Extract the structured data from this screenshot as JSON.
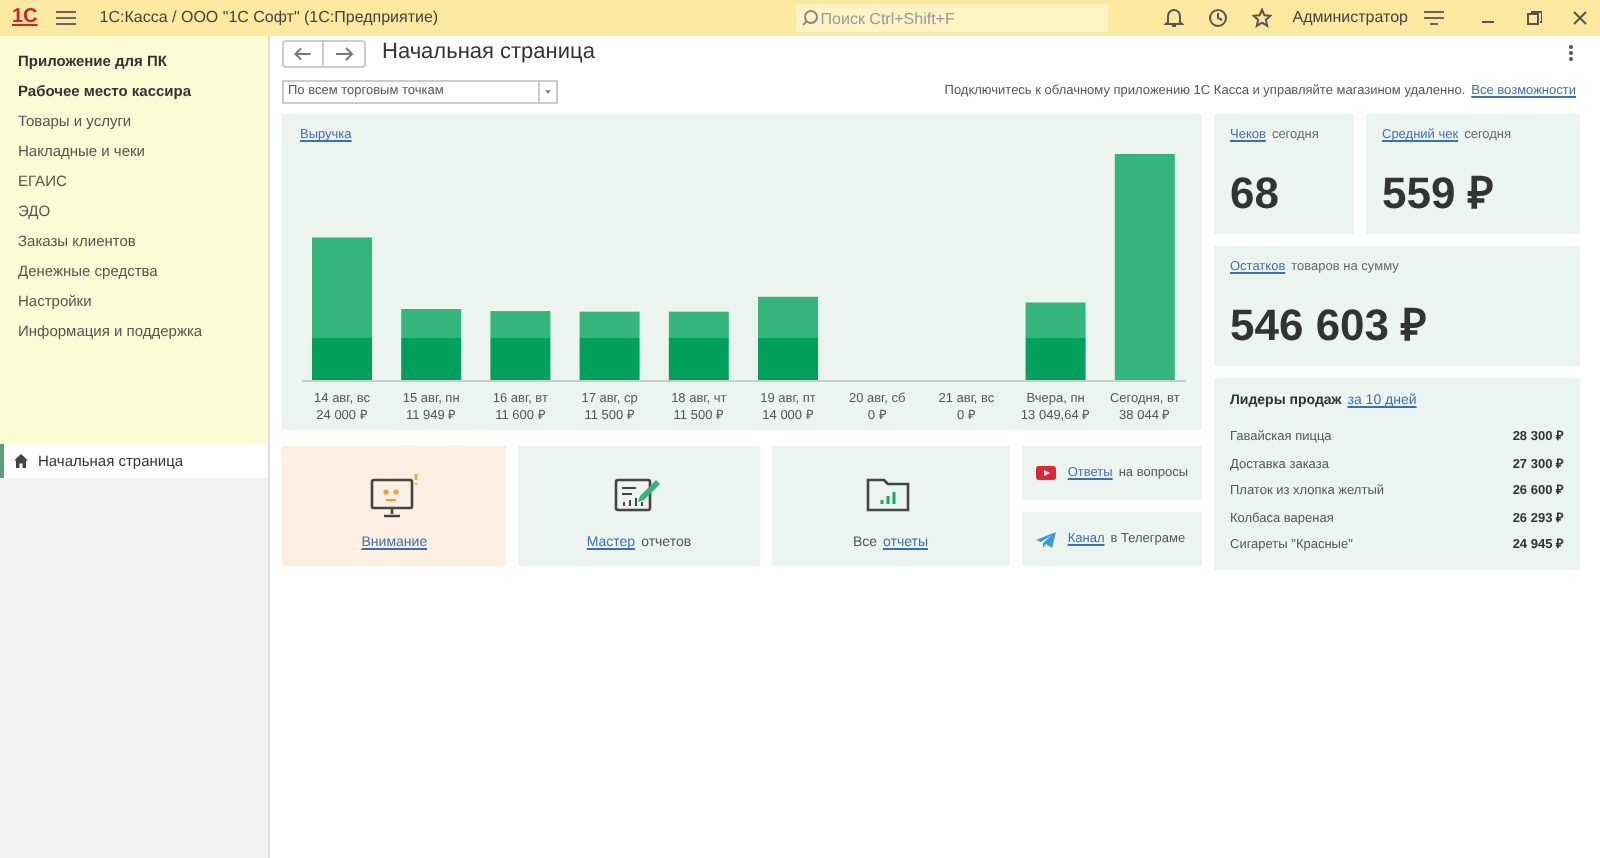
{
  "window": {
    "logo": "1С",
    "title": "1С:Касса / ООО \"1С Софт\"  (1С:Предприятие)",
    "search_placeholder": "Поиск Ctrl+Shift+F",
    "user": "Администратор"
  },
  "sidebar": {
    "items": [
      {
        "label": "Приложение для ПК",
        "bold": true
      },
      {
        "label": "Рабочее место кассира",
        "bold": true
      },
      {
        "label": "Товары и услуги",
        "bold": false
      },
      {
        "label": "Накладные и чеки",
        "bold": false
      },
      {
        "label": "ЕГАИС",
        "bold": false
      },
      {
        "label": "ЭДО",
        "bold": false
      },
      {
        "label": "Заказы клиентов",
        "bold": false
      },
      {
        "label": "Денежные средства",
        "bold": false
      },
      {
        "label": "Настройки",
        "bold": false
      },
      {
        "label": "Информация и поддержка",
        "bold": false
      }
    ],
    "open_pages": [
      {
        "label": "Начальная страница",
        "selected": true
      }
    ]
  },
  "page": {
    "title": "Начальная страница",
    "store_filter": "По всем торговым точкам",
    "promo": "Подключитесь к облачному приложению 1С Касса и управляйте магазином удаленно.",
    "promo_link": "Все возможности"
  },
  "revenue": {
    "title": "Выручка",
    "chart_data": {
      "type": "bar",
      "categories": [
        "14 авг, вс",
        "15 авг, пн",
        "16 авг, вт",
        "17 авг, ср",
        "18 авг, чт",
        "19 авг, пт",
        "20 авг, сб",
        "21 авг, вс",
        "Вчера, пн",
        "Сегодня, вт"
      ],
      "values": [
        24000,
        11949,
        11600,
        11500,
        11500,
        14000,
        0,
        0,
        13049.64,
        38044
      ],
      "value_labels": [
        "24 000 ₽",
        "11 949 ₽",
        "11 600 ₽",
        "11 500 ₽",
        "11 500 ₽",
        "14 000 ₽",
        "0 ₽",
        "0 ₽",
        "13 049,64 ₽",
        "38 044 ₽"
      ]
    }
  },
  "stats": [
    {
      "link": "Чеков",
      "label": "сегодня",
      "value": "68"
    },
    {
      "link": "Средний чек",
      "label": "сегодня",
      "value": "559 ₽"
    },
    {
      "link": "Остатков",
      "label": "товаров на сумму",
      "value": "546 603 ₽"
    }
  ],
  "leaders": {
    "title": "Лидеры продаж",
    "period": "за 10 дней",
    "items": [
      {
        "name": "Гавайская пицца",
        "amount": "28 300 ₽"
      },
      {
        "name": "Доставка заказа",
        "amount": "27 300 ₽"
      },
      {
        "name": "Платок из хлопка желтый",
        "amount": "26 600 ₽"
      },
      {
        "name": "Колбаса вареная",
        "amount": "26 293 ₽"
      },
      {
        "name": "Сигареты \"Красные\"",
        "amount": "24 945 ₽"
      }
    ]
  },
  "tiles": [
    {
      "kind": "attention",
      "link": "Внимание"
    },
    {
      "kind": "wizard",
      "link": "Мастер",
      "text": "отчетов",
      "link_first": true
    },
    {
      "kind": "reports",
      "link": "отчеты",
      "text": "Все",
      "link_first": false
    }
  ],
  "help": [
    {
      "kind": "video",
      "link": "Ответы",
      "text": "на вопросы"
    },
    {
      "kind": "telegram",
      "link": "Канал",
      "text": "в Телеграме"
    }
  ]
}
